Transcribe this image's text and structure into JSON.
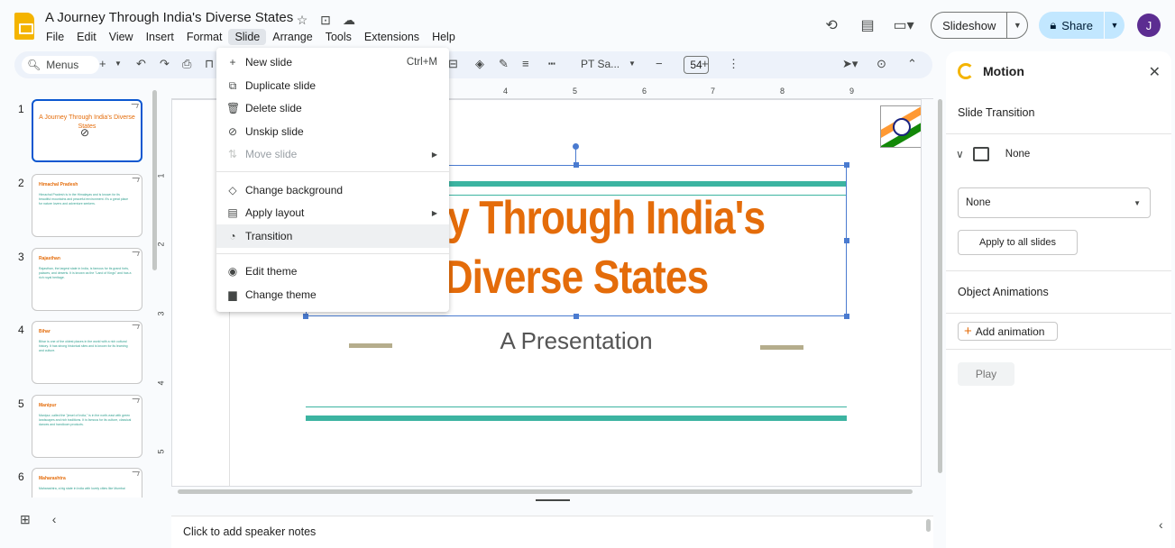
{
  "app": {
    "title": "A Journey Through India's Diverse States",
    "menus": [
      "File",
      "Edit",
      "View",
      "Insert",
      "Format",
      "Slide",
      "Arrange",
      "Tools",
      "Extensions",
      "Help"
    ],
    "active_menu": "Slide"
  },
  "header": {
    "slideshow_label": "Slideshow",
    "share_label": "Share",
    "avatar_initial": "J"
  },
  "toolbar": {
    "search_placeholder": "Menus",
    "font_name": "PT Sa...",
    "font_size": "54"
  },
  "filmstrip": {
    "slides": [
      {
        "num": "1",
        "title": "A Journey Through India's Diverse States",
        "skipped": true
      },
      {
        "num": "2",
        "title": "Himachal Pradesh",
        "body": "Himachal Pradesh is in the Himalayas and is known for its beautiful mountains and peaceful environment. It's a great place for nature lovers and adventure seekers."
      },
      {
        "num": "3",
        "title": "Rajasthan",
        "body": "Rajasthan, the largest state in India, is famous for its grand forts, palaces, and deserts. It is known as the \"Land of Kings\" and has a rich royal heritage."
      },
      {
        "num": "4",
        "title": "Bihar",
        "body": "Bihar is one of the oldest places in the world with a rich cultural history. It has strong historical sites and is known for its learning and culture."
      },
      {
        "num": "5",
        "title": "Manipur",
        "body": "Manipur, called the \"jewel of India,\" is in the north-east with green landscapes and rich traditions. It is famous for its culture, classical dances and handloom products."
      },
      {
        "num": "6",
        "title": "Maharashtra",
        "body": "Maharashtra, a big state in India with lovely cities like Mumbai"
      }
    ]
  },
  "ruler": {
    "h_ticks": [
      "4",
      "5",
      "6",
      "7",
      "8",
      "9"
    ],
    "v_ticks": [
      "1",
      "2",
      "3",
      "4",
      "5"
    ]
  },
  "slide": {
    "title": "A Journey Through India's Diverse States",
    "title_visible_line1": "rney Through India's",
    "title_visible_line2": "Diverse States",
    "subtitle": "A Presentation"
  },
  "notes": {
    "placeholder": "Click to add speaker notes"
  },
  "slide_menu": {
    "items": [
      {
        "icon": "plus-icon",
        "label": "New slide",
        "shortcut": "Ctrl+M"
      },
      {
        "icon": "duplicate-icon",
        "label": "Duplicate slide"
      },
      {
        "icon": "trash-icon",
        "label": "Delete slide"
      },
      {
        "icon": "eye-off-icon",
        "label": "Unskip slide"
      },
      {
        "icon": "move-icon",
        "label": "Move slide",
        "disabled": true,
        "submenu": true
      },
      {
        "icon": "paint-bucket-icon",
        "label": "Change background"
      },
      {
        "icon": "layout-icon",
        "label": "Apply layout",
        "submenu": true
      },
      {
        "icon": "transition-icon",
        "label": "Transition",
        "highlighted": true
      },
      {
        "icon": "palette-icon",
        "label": "Edit theme"
      },
      {
        "icon": "paint-roller-icon",
        "label": "Change theme"
      }
    ]
  },
  "motion_panel": {
    "title": "Motion",
    "slide_transition_heading": "Slide Transition",
    "transition_summary": "None",
    "transition_select_value": "None",
    "apply_all_label": "Apply to all slides",
    "object_animations_heading": "Object Animations",
    "add_animation_label": "Add animation",
    "play_label": "Play"
  },
  "colors": {
    "accent_orange": "#e46c0a",
    "teal_lines": "#3cb4a1",
    "selection_blue": "#4a7bd0",
    "share_bg": "#c2e7ff"
  }
}
